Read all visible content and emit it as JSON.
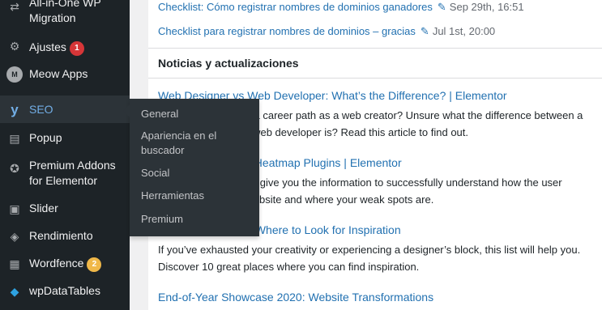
{
  "sidebar": {
    "items": [
      {
        "name": "all-in-one-wp-migration",
        "label_line1": "All-in-One WP",
        "label_line2": "Migration",
        "icon": "migration-icon"
      },
      {
        "name": "ajustes",
        "label": "Ajustes",
        "badge": "1",
        "icon": "sliders-icon"
      },
      {
        "name": "meow-apps",
        "label": "Meow Apps",
        "icon": "meow-icon"
      },
      {
        "name": "seo",
        "label": "SEO",
        "icon": "yoast-icon"
      },
      {
        "name": "popup",
        "label": "Popup",
        "icon": "document-icon"
      },
      {
        "name": "premium-addons",
        "label_line1": "Premium Addons",
        "label_line2": "for Elementor",
        "icon": "star-icon"
      },
      {
        "name": "slider",
        "label": "Slider",
        "icon": "slider-icon"
      },
      {
        "name": "rendimiento",
        "label": "Rendimiento",
        "icon": "database-icon"
      },
      {
        "name": "wordfence",
        "label": "Wordfence",
        "badge": "2",
        "icon": "wordfence-icon"
      },
      {
        "name": "wpdatatables",
        "label": "wpDataTables",
        "icon": "table-icon"
      }
    ]
  },
  "seo_submenu": {
    "general": "General",
    "apariencia_1": "Apariencia en el",
    "apariencia_2": "buscador",
    "social": "Social",
    "herramientas": "Herramientas",
    "premium": "Premium"
  },
  "main": {
    "drafts": [
      {
        "title": "Checklist: Cómo registrar nombres de dominios ganadores",
        "date": "Sep 29th, 16:51"
      },
      {
        "title": "Checklist para registrar nombres de dominios – gracias",
        "date": "Jul 1st, 20:00"
      }
    ],
    "news_heading": "Noticias y actualizaciones",
    "news": [
      {
        "title": "Web Designer vs Web Developer: What’s the Difference? | Elementor",
        "text1": "Are you considering a career path as a web creator? Unsure what the difference between a",
        "text2": "web designer and a web developer is? Read this article to find out."
      },
      {
        "title": "Top 10 WordPress Heatmap Plugins | Elementor",
        "text1": "Heatmap plugins can give you the information to successfully understand how the user",
        "text2": "interacts with your website and where your weak spots are."
      },
      {
        "title": "Design Inspiration: Where to Look for Inspiration",
        "text1": "If you’ve exhausted your creativity or experiencing a designer’s block, this list will help you.",
        "text2": "Discover 10 great places where you can find inspiration."
      },
      {
        "title": "End-of-Year Showcase 2020: Website Transformations"
      }
    ]
  },
  "colors": {
    "sidebar_bg": "#1d2327",
    "submenu_bg": "#2c3338",
    "link": "#2271b1",
    "active": "#72aee6",
    "badge_red": "#d63638",
    "badge_orange": "#f0b849"
  }
}
